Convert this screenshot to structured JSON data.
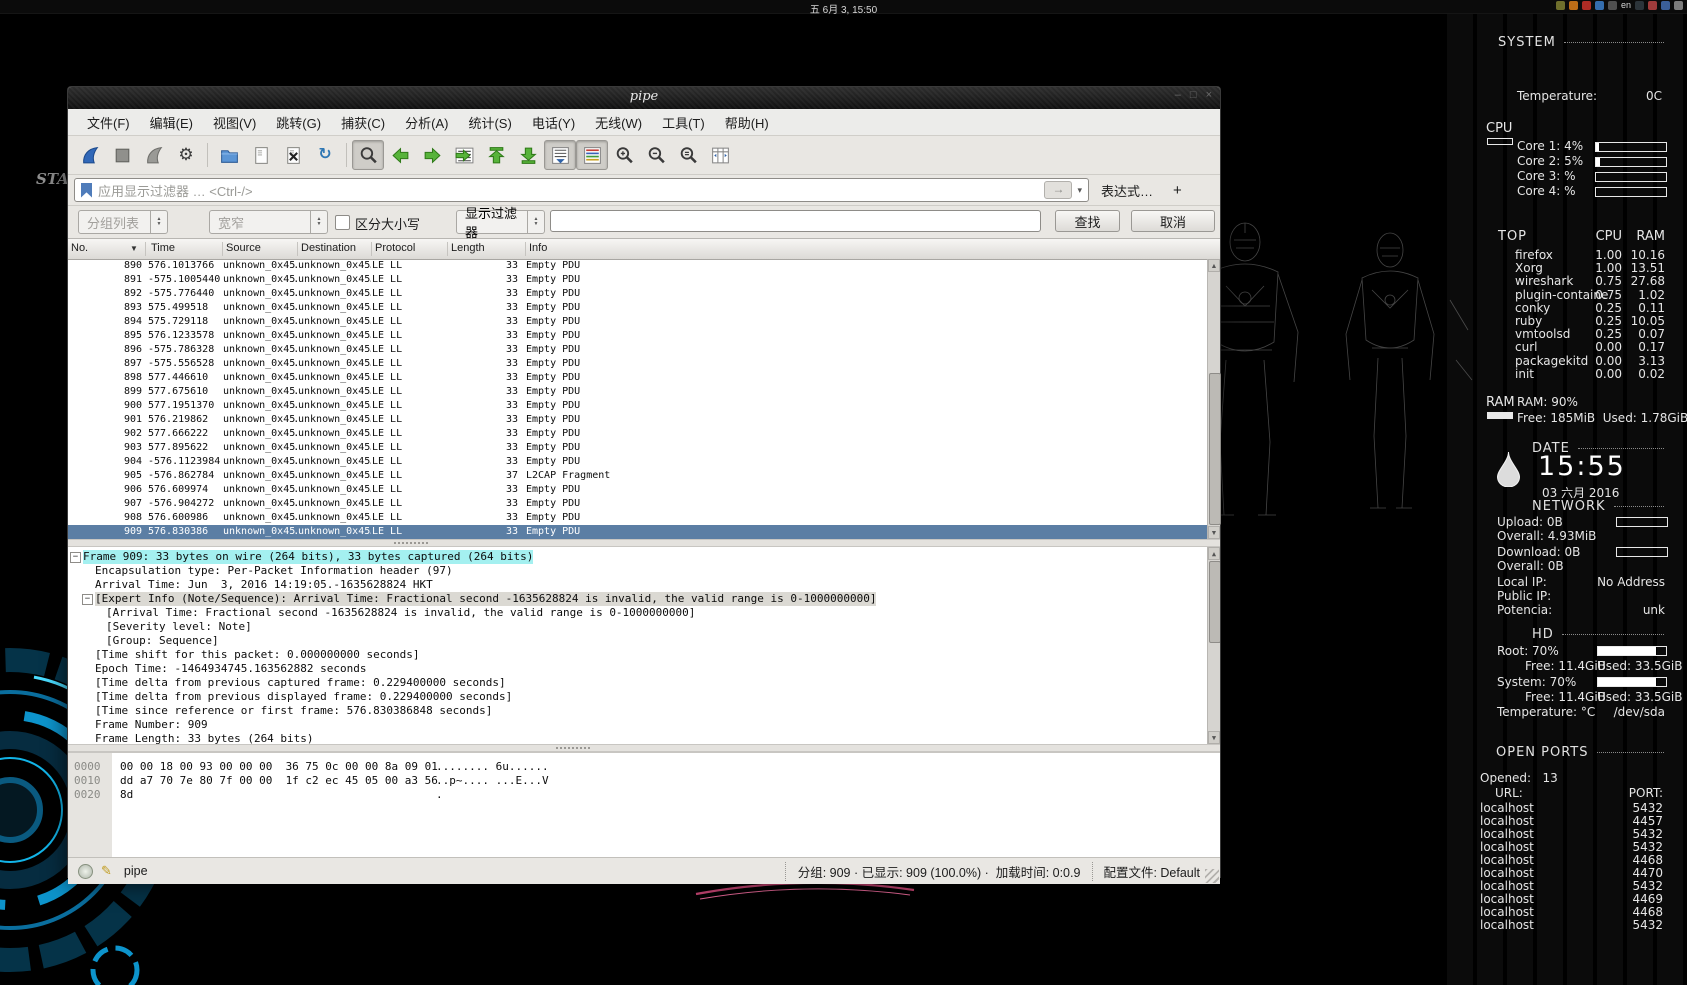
{
  "desktop": {
    "top_bar": {
      "clock": "五 6月 3, 15:50",
      "tray": [
        {
          "name": "updates-icon",
          "color": "#7a7a30"
        },
        {
          "name": "install-icon",
          "color": "#d07818"
        },
        {
          "name": "error-icon",
          "color": "#c03028"
        },
        {
          "name": "network-icon",
          "color": "#3878c0"
        },
        {
          "name": "volume-icon",
          "color": "#585858"
        },
        {
          "name": "keyboard-layout-indicator",
          "label": "en"
        },
        {
          "name": "shield-icon",
          "color": "#30383f"
        },
        {
          "name": "message-icon",
          "color": "#b04040"
        },
        {
          "name": "drive-icon",
          "color": "#4068a8"
        },
        {
          "name": "session-icon",
          "color": "#888888"
        }
      ]
    },
    "background_text": "STA"
  },
  "conky": {
    "system": {
      "header": "SYSTEM",
      "temperature_label": "Temperature:",
      "temperature_value": "0C"
    },
    "cpu": {
      "label": "CPU",
      "cores": [
        {
          "text": "Core 1: 4%",
          "pct": 4
        },
        {
          "text": "Core 2: 5%",
          "pct": 5
        },
        {
          "text": "Core 3: %",
          "pct": 0
        },
        {
          "text": "Core 4: %",
          "pct": 0
        }
      ]
    },
    "top": {
      "header": "TOP",
      "col_cpu": "CPU",
      "col_ram": "RAM",
      "processes": [
        {
          "name": "firefox",
          "cpu": "1.00",
          "ram": "10.16"
        },
        {
          "name": "Xorg",
          "cpu": "1.00",
          "ram": "13.51"
        },
        {
          "name": "wireshark",
          "cpu": "0.75",
          "ram": "27.68"
        },
        {
          "name": "plugin-containe",
          "cpu": "0.75",
          "ram": "1.02"
        },
        {
          "name": "conky",
          "cpu": "0.25",
          "ram": "0.11"
        },
        {
          "name": "ruby",
          "cpu": "0.25",
          "ram": "10.05"
        },
        {
          "name": "vmtoolsd",
          "cpu": "0.25",
          "ram": "0.07"
        },
        {
          "name": "curl",
          "cpu": "0.00",
          "ram": "0.17"
        },
        {
          "name": "packagekitd",
          "cpu": "0.00",
          "ram": "3.13"
        },
        {
          "name": "init",
          "cpu": "0.00",
          "ram": "0.02"
        }
      ]
    },
    "ram": {
      "label": "RAM",
      "usage": "RAM: 90%",
      "detail": "Free: 185MiB  Used: 1.78GiB"
    },
    "date": {
      "header": "DATE",
      "time": "15:55",
      "date": "03 六月 2016"
    },
    "network": {
      "header": "NETWORK",
      "upload_label": "Upload: 0B",
      "upload_overall": "Overall: 4.93MiB",
      "download_label": "Download: 0B",
      "download_overall": "Overall: 0B",
      "local_ip_label": "Local IP:",
      "local_ip": "No Address",
      "public_ip_label": "Public IP:",
      "public_ip": "",
      "power_label": "Potencia:",
      "power": "unk"
    },
    "hd": {
      "header": "HD",
      "root_label": "Root: 70%",
      "root_pct": 85,
      "root_free": "Free: 11.4GiB",
      "root_used": "Used: 33.5GiB",
      "system_label": "System: 70%",
      "system_pct": 85,
      "system_free": "Free: 11.4GiB",
      "system_used": "Used: 33.5GiB",
      "temp_label": "Temperature: °C",
      "device": "/dev/sda"
    },
    "open_ports": {
      "header": "OPEN PORTS",
      "opened": "Opened:   13",
      "url_label": "URL:",
      "port_label": "PORT:",
      "ports": [
        {
          "host": "localhost",
          "port": "5432"
        },
        {
          "host": "localhost",
          "port": "4457"
        },
        {
          "host": "localhost",
          "port": "5432"
        },
        {
          "host": "localhost",
          "port": "5432"
        },
        {
          "host": "localhost",
          "port": "4468"
        },
        {
          "host": "localhost",
          "port": "4470"
        },
        {
          "host": "localhost",
          "port": "5432"
        },
        {
          "host": "localhost",
          "port": "4469"
        },
        {
          "host": "localhost",
          "port": "4468"
        },
        {
          "host": "localhost",
          "port": "5432"
        }
      ]
    }
  },
  "wireshark": {
    "title": "pipe",
    "window_controls": {
      "minimize": "–",
      "maximize": "□",
      "close": "×"
    },
    "menu": [
      "文件(F)",
      "编辑(E)",
      "视图(V)",
      "跳转(G)",
      "捕获(C)",
      "分析(A)",
      "统计(S)",
      "电话(Y)",
      "无线(W)",
      "工具(T)",
      "帮助(H)"
    ],
    "toolbar": [
      {
        "name": "start-capture-icon",
        "kind": "fin-blue"
      },
      {
        "name": "stop-capture-icon",
        "kind": "stop"
      },
      {
        "name": "restart-capture-icon",
        "kind": "fin-gray"
      },
      {
        "name": "capture-options-icon",
        "kind": "gear"
      },
      {
        "name": "toolbar-separator",
        "kind": "sep"
      },
      {
        "name": "open-file-icon",
        "kind": "folder"
      },
      {
        "name": "save-file-icon",
        "kind": "doc-save"
      },
      {
        "name": "close-file-icon",
        "kind": "doc-close"
      },
      {
        "name": "reload-file-icon",
        "kind": "reload"
      },
      {
        "name": "toolbar-separator",
        "kind": "sep"
      },
      {
        "name": "find-packet-icon",
        "kind": "find",
        "pressed": true
      },
      {
        "name": "go-back-icon",
        "kind": "arrow-left"
      },
      {
        "name": "go-forward-icon",
        "kind": "arrow-right"
      },
      {
        "name": "go-to-packet-icon",
        "kind": "goto"
      },
      {
        "name": "go-first-icon",
        "kind": "arrow-first"
      },
      {
        "name": "go-last-icon",
        "kind": "arrow-last"
      },
      {
        "name": "auto-scroll-icon",
        "kind": "autoscroll",
        "pressed": true
      },
      {
        "name": "colorize-icon",
        "kind": "colorize",
        "pressed": true
      },
      {
        "name": "zoom-in-icon",
        "kind": "zoom-in"
      },
      {
        "name": "zoom-out-icon",
        "kind": "zoom-out"
      },
      {
        "name": "zoom-100-icon",
        "kind": "zoom-orig"
      },
      {
        "name": "resize-columns-icon",
        "kind": "cols"
      }
    ],
    "filter_bar": {
      "placeholder": "应用显示过滤器 … <Ctrl-/>",
      "apply": "→",
      "caret": "▾",
      "expression": "表达式…",
      "add": "+"
    },
    "find_bar": {
      "scope": "分组列表",
      "width": "宽窄",
      "case_label": "区分大小写",
      "type": "显示过滤器",
      "value": "",
      "find_label": "查找",
      "cancel_label": "取消"
    },
    "packet_list": {
      "columns": [
        "No.",
        "Time",
        "Source",
        "Destination",
        "Protocol",
        "Length",
        "Info"
      ],
      "sort_indicator": "▼",
      "selected_no": "909",
      "rows": [
        [
          "890",
          "576.1013766",
          "unknown_0x45…",
          "unknown_0x45…",
          "LE LL",
          "33",
          "Empty PDU"
        ],
        [
          "891",
          "-575.1005440",
          "unknown_0x45…",
          "unknown_0x45…",
          "LE LL",
          "33",
          "Empty PDU"
        ],
        [
          "892",
          "-575.776440",
          "unknown_0x45…",
          "unknown_0x45…",
          "LE LL",
          "33",
          "Empty PDU"
        ],
        [
          "893",
          "575.499518",
          "unknown_0x45…",
          "unknown_0x45…",
          "LE LL",
          "33",
          "Empty PDU"
        ],
        [
          "894",
          "575.729118",
          "unknown_0x45…",
          "unknown_0x45…",
          "LE LL",
          "33",
          "Empty PDU"
        ],
        [
          "895",
          "576.1233578",
          "unknown_0x45…",
          "unknown_0x45…",
          "LE LL",
          "33",
          "Empty PDU"
        ],
        [
          "896",
          "-575.786328",
          "unknown_0x45…",
          "unknown_0x45…",
          "LE LL",
          "33",
          "Empty PDU"
        ],
        [
          "897",
          "-575.556528",
          "unknown_0x45…",
          "unknown_0x45…",
          "LE LL",
          "33",
          "Empty PDU"
        ],
        [
          "898",
          "577.446610",
          "unknown_0x45…",
          "unknown_0x45…",
          "LE LL",
          "33",
          "Empty PDU"
        ],
        [
          "899",
          "577.675610",
          "unknown_0x45…",
          "unknown_0x45…",
          "LE LL",
          "33",
          "Empty PDU"
        ],
        [
          "900",
          "577.1951370",
          "unknown_0x45…",
          "unknown_0x45…",
          "LE LL",
          "33",
          "Empty PDU"
        ],
        [
          "901",
          "576.219862",
          "unknown_0x45…",
          "unknown_0x45…",
          "LE LL",
          "33",
          "Empty PDU"
        ],
        [
          "902",
          "577.666222",
          "unknown_0x45…",
          "unknown_0x45…",
          "LE LL",
          "33",
          "Empty PDU"
        ],
        [
          "903",
          "577.895622",
          "unknown_0x45…",
          "unknown_0x45…",
          "LE LL",
          "33",
          "Empty PDU"
        ],
        [
          "904",
          "-576.1123984",
          "unknown_0x45…",
          "unknown_0x45…",
          "LE LL",
          "33",
          "Empty PDU"
        ],
        [
          "905",
          "-576.862784",
          "unknown_0x45…",
          "unknown_0x45…",
          "LE LL",
          "37",
          "L2CAP Fragment"
        ],
        [
          "906",
          "576.609974",
          "unknown_0x45…",
          "unknown_0x45…",
          "LE LL",
          "33",
          "Empty PDU"
        ],
        [
          "907",
          "-576.904272",
          "unknown_0x45…",
          "unknown_0x45…",
          "LE LL",
          "33",
          "Empty PDU"
        ],
        [
          "908",
          "576.600986",
          "unknown_0x45…",
          "unknown_0x45…",
          "LE LL",
          "33",
          "Empty PDU"
        ],
        [
          "909",
          "576.830386",
          "unknown_0x45…",
          "unknown_0x45…",
          "LE LL",
          "33",
          "Empty PDU"
        ]
      ]
    },
    "packet_details": {
      "lines": [
        {
          "text": "Frame 909: 33 bytes on wire (264 bits), 33 bytes captured (264 bits)",
          "indent": 0,
          "expandable": true,
          "highlight": "cyan"
        },
        {
          "text": "Encapsulation type: Per-Packet Information header (97)",
          "indent": 1
        },
        {
          "text": "Arrival Time: Jun  3, 2016 14:19:05.-1635628824 HKT",
          "indent": 1
        },
        {
          "text": "[Expert Info (Note/Sequence): Arrival Time: Fractional second -1635628824 is invalid, the valid range is 0-1000000000]",
          "indent": 1,
          "expandable": true,
          "highlight": "gray"
        },
        {
          "text": "[Arrival Time: Fractional second -1635628824 is invalid, the valid range is 0-1000000000]",
          "indent": 2
        },
        {
          "text": "[Severity level: Note]",
          "indent": 2
        },
        {
          "text": "[Group: Sequence]",
          "indent": 2
        },
        {
          "text": "[Time shift for this packet: 0.000000000 seconds]",
          "indent": 1
        },
        {
          "text": "Epoch Time: -1464934745.163562882 seconds",
          "indent": 1
        },
        {
          "text": "[Time delta from previous captured frame: 0.229400000 seconds]",
          "indent": 1
        },
        {
          "text": "[Time delta from previous displayed frame: 0.229400000 seconds]",
          "indent": 1
        },
        {
          "text": "[Time since reference or first frame: 576.830386848 seconds]",
          "indent": 1
        },
        {
          "text": "Frame Number: 909",
          "indent": 1
        },
        {
          "text": "Frame Length: 33 bytes (264 bits)",
          "indent": 1
        }
      ]
    },
    "packet_bytes": {
      "rows": [
        {
          "offset": "0000",
          "hex": "00 00 18 00 93 00 00 00  36 75 0c 00 00 8a 09 01",
          "ascii": "........ 6u......"
        },
        {
          "offset": "0010",
          "hex": "dd a7 70 7e 80 7f 00 00  1f c2 ec 45 05 00 a3 56",
          "ascii": "..p~.... ...E...V"
        },
        {
          "offset": "0020",
          "hex": "8d",
          "ascii": "."
        }
      ]
    },
    "status_bar": {
      "file": "pipe",
      "stats": "分组: 909 · 已显示: 909 (100.0%) ·  加载时间: 0:0.9",
      "profile": "配置文件: Default"
    }
  }
}
